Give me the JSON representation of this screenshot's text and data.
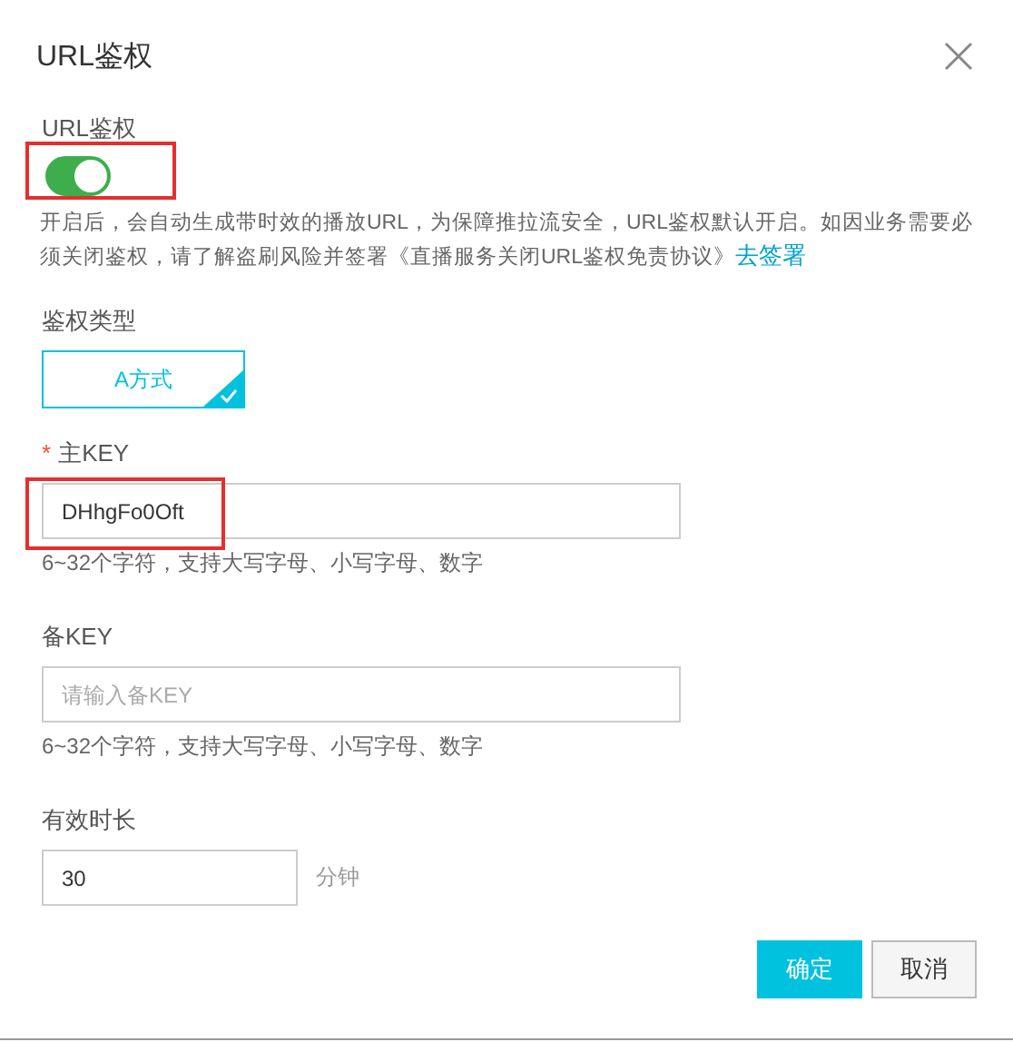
{
  "dialog": {
    "title": "URL鉴权"
  },
  "auth_switch": {
    "label": "URL鉴权",
    "on": true,
    "highlighted": true,
    "description": "开启后，会自动生成带时效的播放URL，为保障推拉流安全，URL鉴权默认开启。如因业务需要必须关闭鉴权，请了解盗刷风险并签署《直播服务关闭URL鉴权免责协议》",
    "link": "去签署"
  },
  "auth_type": {
    "label": "鉴权类型",
    "options": [
      {
        "label": "A方式",
        "selected": true
      }
    ]
  },
  "main_key": {
    "label": "主KEY",
    "required_mark": "*",
    "value": "DHhgFo0Oft",
    "highlighted": true,
    "hint": "6~32个字符，支持大写字母、小写字母、数字"
  },
  "backup_key": {
    "label": "备KEY",
    "placeholder": "请输入备KEY",
    "hint": "6~32个字符，支持大写字母、小写字母、数字"
  },
  "duration": {
    "label": "有效时长",
    "value": "30",
    "unit": "分钟"
  },
  "buttons": [
    {
      "label": "确定",
      "kind": "primary"
    },
    {
      "label": "取消",
      "kind": "secondary"
    }
  ]
}
